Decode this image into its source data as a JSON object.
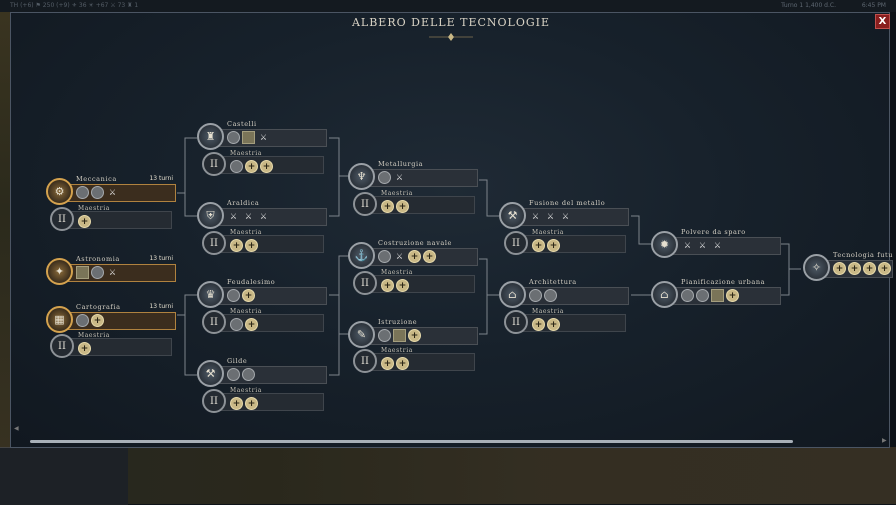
{
  "topbar": {
    "left": "TH (+6)  ⚑ 250 (+9)  ⚜ 36  ☀ +67  ⚔ 73  ♜ 1",
    "turn": "Turno 1 1,400 d.C.",
    "time": "6:45 PM"
  },
  "panel": {
    "title": "ALBERO DELLE TECNOLOGIE",
    "close_label": "X"
  },
  "techs": [
    {
      "key": "meccanica",
      "name": "Meccanica",
      "turns": "13 turni",
      "highlighted": true,
      "icon": "gear-icon",
      "unlocks": [
        "c",
        "c",
        "w"
      ]
    },
    {
      "key": "astronomia",
      "name": "Astronomia",
      "turns": "13 turni",
      "highlighted": true,
      "icon": "telescope-icon",
      "unlocks": [
        "s",
        "c",
        "w"
      ]
    },
    {
      "key": "cartografia",
      "name": "Cartografia",
      "turns": "13 turni",
      "highlighted": true,
      "icon": "map-icon",
      "unlocks": [
        "c",
        "p"
      ]
    },
    {
      "key": "castelli",
      "name": "Castelli",
      "turns": "",
      "highlighted": false,
      "icon": "castle-icon",
      "unlocks": [
        "c",
        "s",
        "w"
      ]
    },
    {
      "key": "araldica",
      "name": "Araldica",
      "turns": "",
      "highlighted": false,
      "icon": "shield-icon",
      "unlocks": [
        "w",
        "w",
        "w"
      ]
    },
    {
      "key": "feudalesimo",
      "name": "Feudalesimo",
      "turns": "",
      "highlighted": false,
      "icon": "crown-icon",
      "unlocks": [
        "c",
        "p"
      ]
    },
    {
      "key": "gilde",
      "name": "Gilde",
      "turns": "",
      "highlighted": false,
      "icon": "hammer-icon",
      "unlocks": [
        "c",
        "c"
      ]
    },
    {
      "key": "metallurgia",
      "name": "Metallurgia",
      "turns": "",
      "highlighted": false,
      "icon": "chalice-icon",
      "unlocks": [
        "c",
        "w"
      ]
    },
    {
      "key": "costruzione",
      "name": "Costruzione navale",
      "turns": "",
      "highlighted": false,
      "icon": "ship-icon",
      "unlocks": [
        "c",
        "w",
        "p",
        "p"
      ]
    },
    {
      "key": "istruzione",
      "name": "Istruzione",
      "turns": "",
      "highlighted": false,
      "icon": "book-icon",
      "unlocks": [
        "c",
        "s",
        "p"
      ]
    },
    {
      "key": "fusione",
      "name": "Fusione del metallo",
      "turns": "",
      "highlighted": false,
      "icon": "anvil-icon",
      "unlocks": [
        "w",
        "w",
        "w"
      ]
    },
    {
      "key": "architettura",
      "name": "Architettura",
      "turns": "",
      "highlighted": false,
      "icon": "dome-icon",
      "unlocks": [
        "c",
        "c"
      ]
    },
    {
      "key": "polvere",
      "name": "Polvere da sparo",
      "turns": "",
      "highlighted": false,
      "icon": "cannon-icon",
      "unlocks": [
        "w",
        "w",
        "w"
      ]
    },
    {
      "key": "pianificazione",
      "name": "Pianificazione urbana",
      "turns": "",
      "highlighted": false,
      "icon": "city-icon",
      "unlocks": [
        "c",
        "c",
        "s",
        "p"
      ]
    },
    {
      "key": "futuro",
      "name": "Tecnologia futu",
      "turns": "",
      "highlighted": false,
      "icon": "future-icon",
      "unlocks": [
        "p",
        "p",
        "p",
        "p"
      ]
    }
  ],
  "masteries": [
    {
      "key": "m-meccanica",
      "label": "Maestria",
      "unlocks": [
        "p"
      ]
    },
    {
      "key": "m-cartografia",
      "label": "Maestria",
      "unlocks": [
        "p"
      ]
    },
    {
      "key": "m-castelli",
      "label": "Maestria",
      "unlocks": [
        "c",
        "p",
        "p"
      ]
    },
    {
      "key": "m-araldica",
      "label": "Maestria",
      "unlocks": [
        "p",
        "p"
      ]
    },
    {
      "key": "m-feudalesimo",
      "label": "Maestria",
      "unlocks": [
        "c",
        "p"
      ]
    },
    {
      "key": "m-gilde",
      "label": "Maestria",
      "unlocks": [
        "p",
        "p"
      ]
    },
    {
      "key": "m-metallurgia",
      "label": "Maestria",
      "unlocks": [
        "p",
        "p"
      ]
    },
    {
      "key": "m-costruzione",
      "label": "Maestria",
      "unlocks": [
        "p",
        "p"
      ]
    },
    {
      "key": "m-istruzione",
      "label": "Maestria",
      "unlocks": [
        "p",
        "p"
      ]
    },
    {
      "key": "m-fusione",
      "label": "Maestria",
      "unlocks": [
        "p",
        "p"
      ]
    },
    {
      "key": "m-architettura",
      "label": "Maestria",
      "unlocks": [
        "p",
        "p"
      ]
    }
  ],
  "mastery_symbol": "II",
  "glyphs": {
    "p": "+",
    "w": "⚔",
    "c": "",
    "s": ""
  },
  "colors": {
    "highlight": "#b0823f",
    "close": "#8a1e1e"
  }
}
